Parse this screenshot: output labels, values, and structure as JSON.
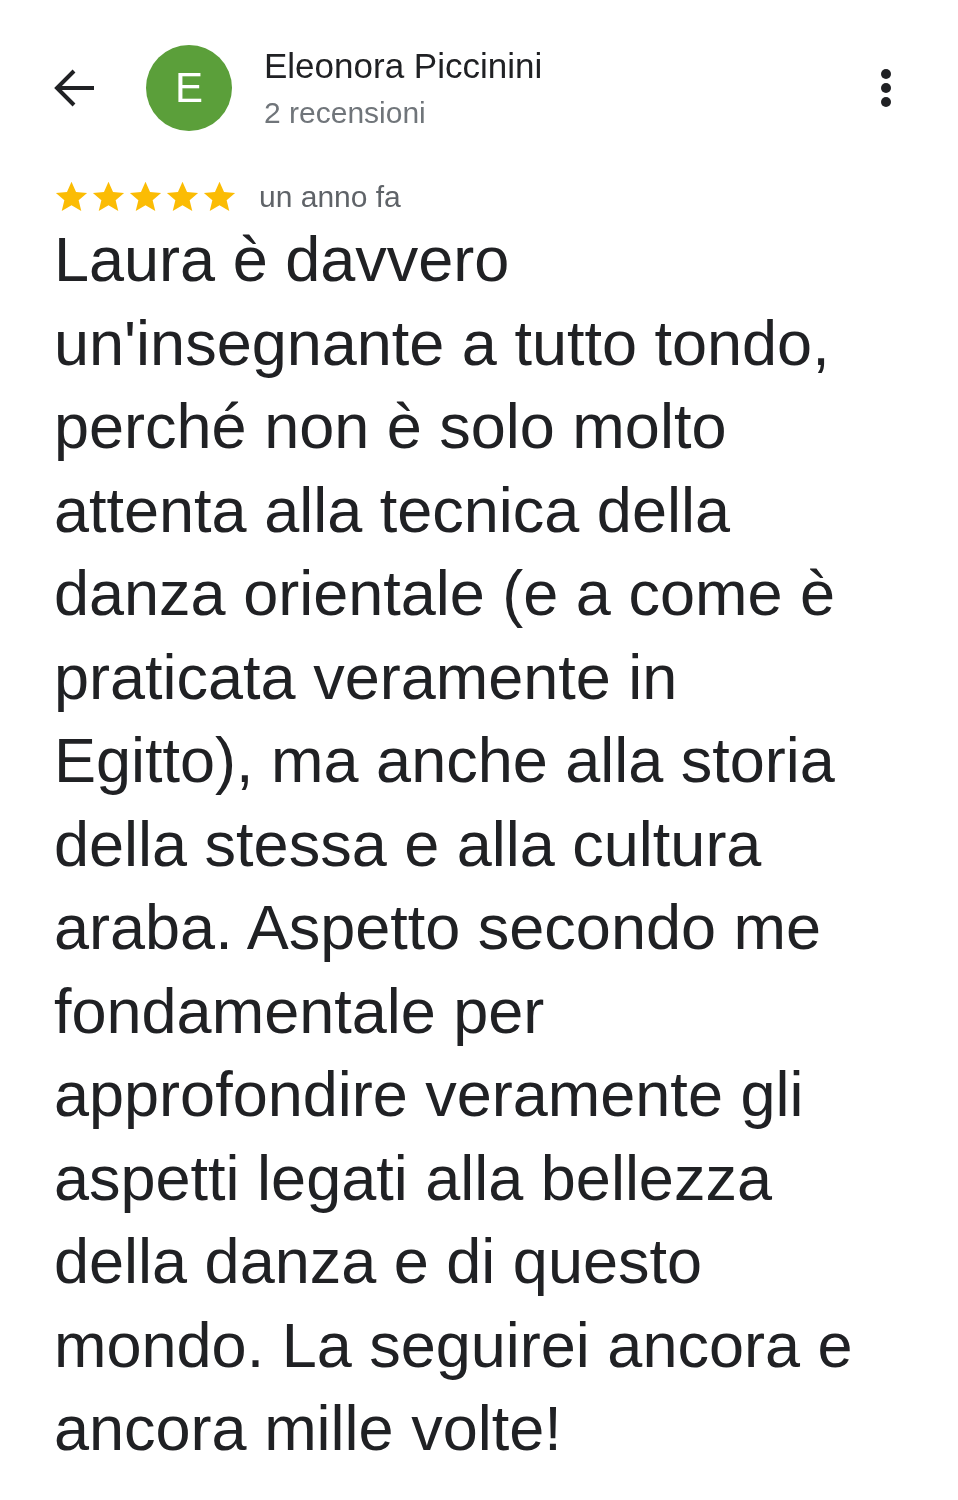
{
  "reviewer": {
    "initial": "E",
    "name": "Eleonora Piccinini",
    "reviews": "2 recensioni"
  },
  "review": {
    "stars": 5,
    "time": "un anno fa",
    "text": "Laura è davvero un'insegnante a tutto tondo, perché non è solo molto attenta alla tecnica della danza orientale (e a come è praticata veramente in Egitto), ma anche alla storia della stessa e alla cultura araba. Aspetto secondo me fondamentale per approfondire veramente gli aspetti legati alla bellezza della danza e di questo mondo. La seguirei ancora e ancora mille volte!"
  }
}
